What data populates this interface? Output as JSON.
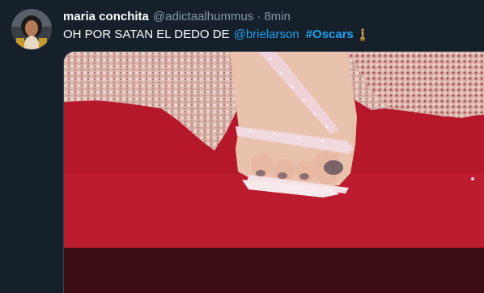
{
  "tweet": {
    "display_name": "maria conchita",
    "handle": "@adictaalhummus",
    "separator": "·",
    "time": "8min",
    "text": "OH POR SATAN EL DEDO DE",
    "mention": "@brielarson",
    "hashtag": "#Oscars",
    "hashtag_icon": "oscar-statuette-icon"
  },
  "colors": {
    "background": "#15202b",
    "name": "#ffffff",
    "muted": "#8899a6",
    "link": "#1da1f2",
    "carpet": "#b5182a"
  }
}
